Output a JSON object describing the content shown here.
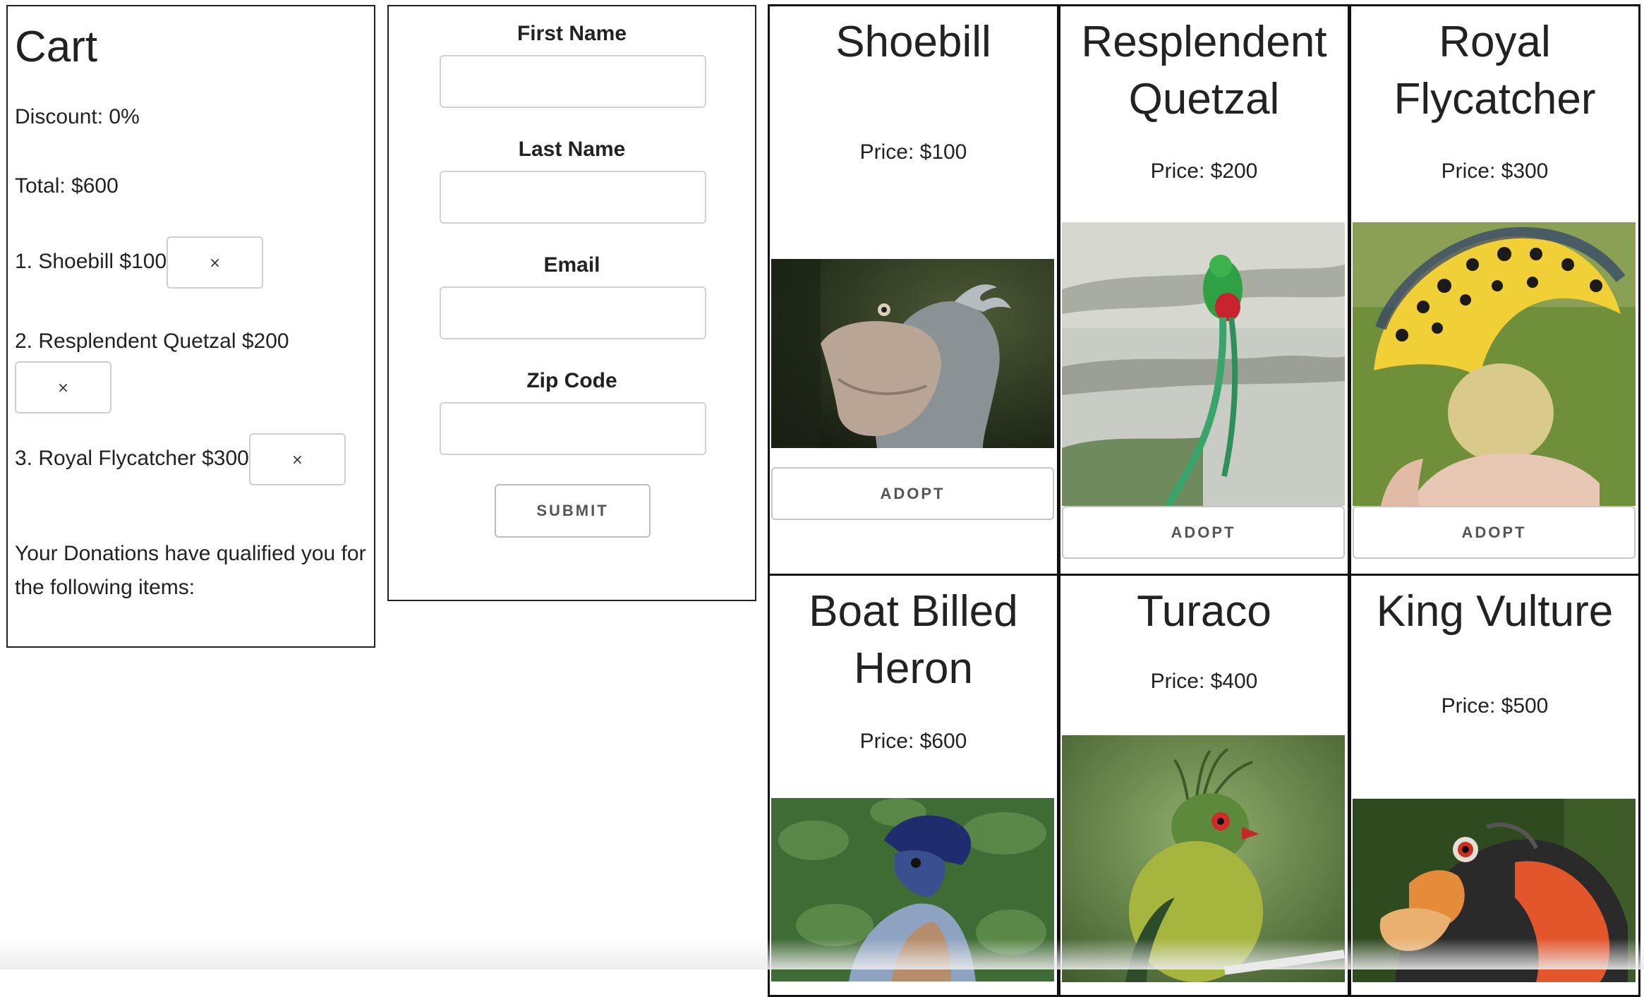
{
  "cart": {
    "title": "Cart",
    "discount": "Discount: 0%",
    "total": "Total: $600",
    "items": [
      {
        "label": "1. Shoebill $100",
        "remove": "×"
      },
      {
        "label": "2. Resplendent Quetzal $200",
        "remove": "×"
      },
      {
        "label": "3. Royal Flycatcher $300",
        "remove": "×"
      }
    ],
    "qualified_text": "Your Donations have qualified you for the following items:"
  },
  "form": {
    "fields": [
      {
        "label": "First Name",
        "value": ""
      },
      {
        "label": "Last Name",
        "value": ""
      },
      {
        "label": "Email",
        "value": ""
      },
      {
        "label": "Zip Code",
        "value": ""
      }
    ],
    "submit_label": "SUBMIT"
  },
  "birds": [
    {
      "name": "Shoebill",
      "price": "Price: $100",
      "adopt_label": "ADOPT"
    },
    {
      "name": "Resplendent Quetzal",
      "price": "Price: $200",
      "adopt_label": "ADOPT"
    },
    {
      "name": "Royal Flycatcher",
      "price": "Price: $300",
      "adopt_label": "ADOPT"
    },
    {
      "name": "Boat Billed Heron",
      "price": "Price: $600"
    },
    {
      "name": "Turaco",
      "price": "Price: $400"
    },
    {
      "name": "King Vulture",
      "price": "Price: $500"
    }
  ]
}
